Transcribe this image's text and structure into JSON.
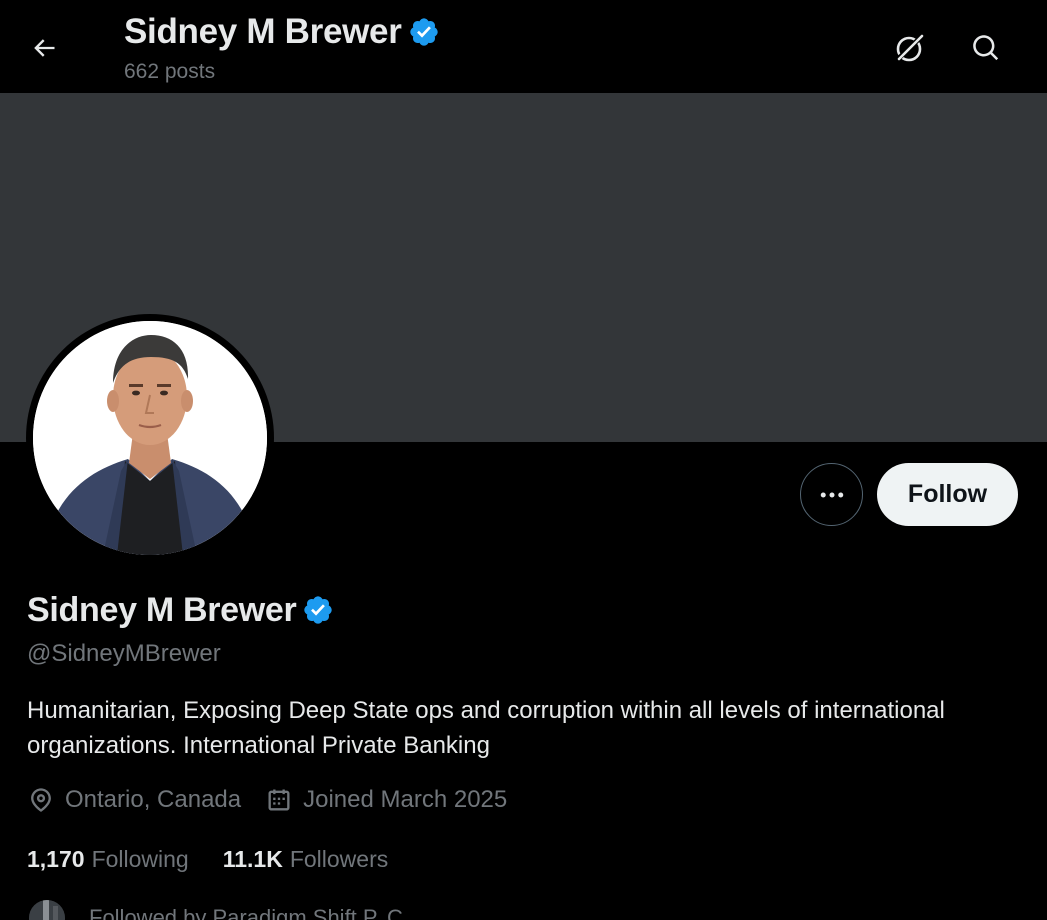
{
  "header": {
    "title": "Sidney M Brewer",
    "post_count": "662 posts",
    "back_icon": "arrow-left-icon",
    "grok_icon": "grok-icon",
    "search_icon": "search-icon"
  },
  "profile": {
    "display_name": "Sidney M Brewer",
    "verified": true,
    "handle": "@SidneyMBrewer",
    "bio": "Humanitarian, Exposing Deep State ops and corruption within all levels of international organizations. International Private Banking",
    "location": "Ontario, Canada",
    "joined": "Joined March 2025",
    "following_count": "1,170",
    "following_label": "Following",
    "followers_count": "11.1K",
    "followers_label": "Followers",
    "followed_by": "Followed by Paradigm Shift P. C."
  },
  "actions": {
    "follow_label": "Follow",
    "more_icon": "more-horizontal-icon"
  },
  "colors": {
    "background": "#000000",
    "banner": "#333639",
    "verified_blue": "#1d9bf0",
    "text_primary": "#e7e9ea",
    "text_secondary": "#71767b",
    "follow_button_bg": "#eff3f4"
  }
}
